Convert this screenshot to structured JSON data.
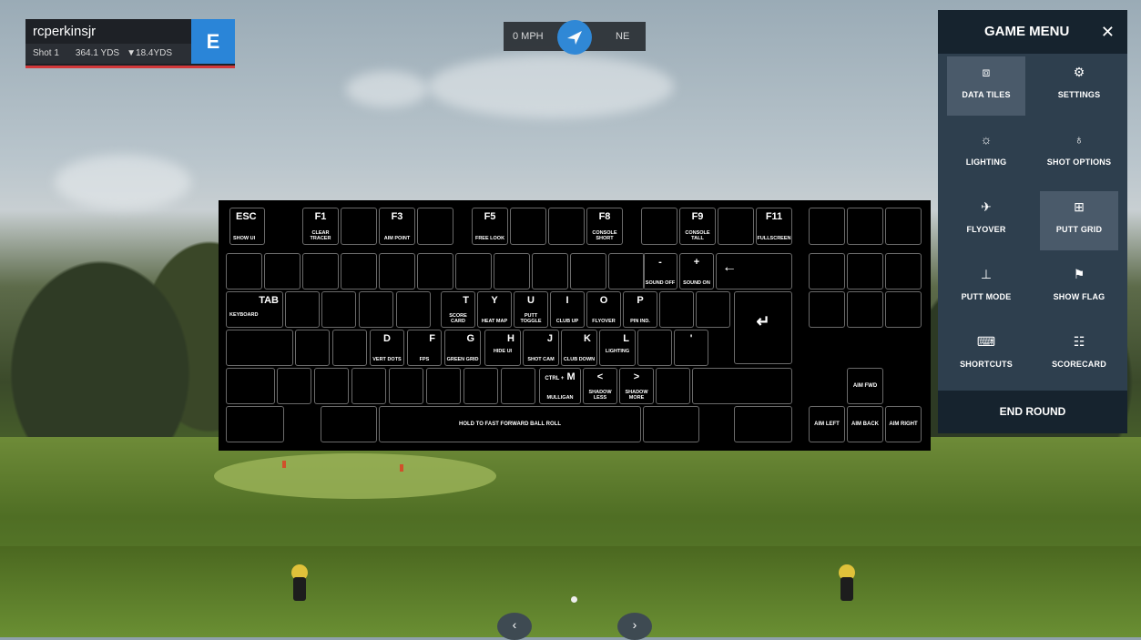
{
  "player": {
    "name": "rcperkinsjr",
    "shot": "Shot 1",
    "distance": "364.1 YDS",
    "remaining": "▼18.4YDS",
    "score": "E"
  },
  "wind": {
    "speed": "0 MPH",
    "direction": "NE"
  },
  "keyboard": {
    "esc": {
      "key": "ESC",
      "label": "SHOW UI"
    },
    "f1": {
      "key": "F1",
      "label": "CLEAR TRACER"
    },
    "f3": {
      "key": "F3",
      "label": "AIM POINT"
    },
    "f5": {
      "key": "F5",
      "label": "FREE LOOK"
    },
    "f8": {
      "key": "F8",
      "label": "CONSOLE SHORT"
    },
    "f9": {
      "key": "F9",
      "label": "CONSOLE TALL"
    },
    "f11": {
      "key": "F11",
      "label": "FULLSCREEN"
    },
    "minus": {
      "key": "-",
      "label": "SOUND OFF"
    },
    "plus": {
      "key": "+",
      "label": "SOUND ON"
    },
    "backspace": {
      "key": "←"
    },
    "tab": {
      "key": "TAB",
      "label": "KEYBOARD"
    },
    "t": {
      "key": "T",
      "label": "SCORE CARD"
    },
    "y": {
      "key": "Y",
      "label": "HEAT MAP"
    },
    "u": {
      "key": "U",
      "label": "PUTT TOGGLE"
    },
    "i": {
      "key": "I",
      "label": "CLUB UP"
    },
    "o": {
      "key": "O",
      "label": "FLYOVER"
    },
    "p": {
      "key": "P",
      "label": "PIN IND."
    },
    "enter": {
      "key": "↵"
    },
    "d": {
      "key": "D",
      "label": "VERT DOTS"
    },
    "f": {
      "key": "F",
      "label": "FPS"
    },
    "g": {
      "key": "G",
      "label": "GREEN GRID"
    },
    "h": {
      "key": "H",
      "label": "HIDE UI"
    },
    "j": {
      "key": "J",
      "label": "SHOT CAM"
    },
    "k": {
      "key": "K",
      "label": "CLUB DOWN"
    },
    "l": {
      "key": "L",
      "label": "LIGHTING"
    },
    "quote": {
      "key": "'"
    },
    "m": {
      "key": "M",
      "mod": "CTRL +",
      "label": "MULLIGAN"
    },
    "comma": {
      "key": "<",
      "label": "SHADOW LESS"
    },
    "period": {
      "key": ">",
      "label": "SHADOW MORE"
    },
    "space": {
      "label": "HOLD TO FAST FORWARD BALL ROLL"
    },
    "up": {
      "label": "AIM FWD"
    },
    "left": {
      "label": "AIM LEFT"
    },
    "down": {
      "label": "AIM BACK"
    },
    "right": {
      "label": "AIM RIGHT"
    }
  },
  "menu": {
    "title": "GAME MENU",
    "close": "✕",
    "tiles": [
      {
        "label": "DATA TILES",
        "icon": "bar-chart-icon",
        "glyph": "⧈",
        "selected": true
      },
      {
        "label": "SETTINGS",
        "icon": "gear-icon",
        "glyph": "⚙",
        "selected": false
      },
      {
        "label": "LIGHTING",
        "icon": "sun-icon",
        "glyph": "☼",
        "selected": false
      },
      {
        "label": "SHOT OPTIONS",
        "icon": "lightbulb-icon",
        "glyph": "♁",
        "selected": false
      },
      {
        "label": "FLYOVER",
        "icon": "airplane-icon",
        "glyph": "✈",
        "selected": false
      },
      {
        "label": "PUTT GRID",
        "icon": "grid-icon",
        "glyph": "⊞",
        "selected": true
      },
      {
        "label": "PUTT MODE",
        "icon": "putter-icon",
        "glyph": "⊥",
        "selected": false
      },
      {
        "label": "SHOW FLAG",
        "icon": "flag-icon",
        "glyph": "⚑",
        "selected": false
      },
      {
        "label": "SHORTCUTS",
        "icon": "keyboard-icon",
        "glyph": "⌨",
        "selected": false
      },
      {
        "label": "SCORECARD",
        "icon": "scorecard-icon",
        "glyph": "☷",
        "selected": false
      }
    ],
    "end_round": "END ROUND"
  },
  "nav": {
    "prev": "‹",
    "next": "›"
  }
}
